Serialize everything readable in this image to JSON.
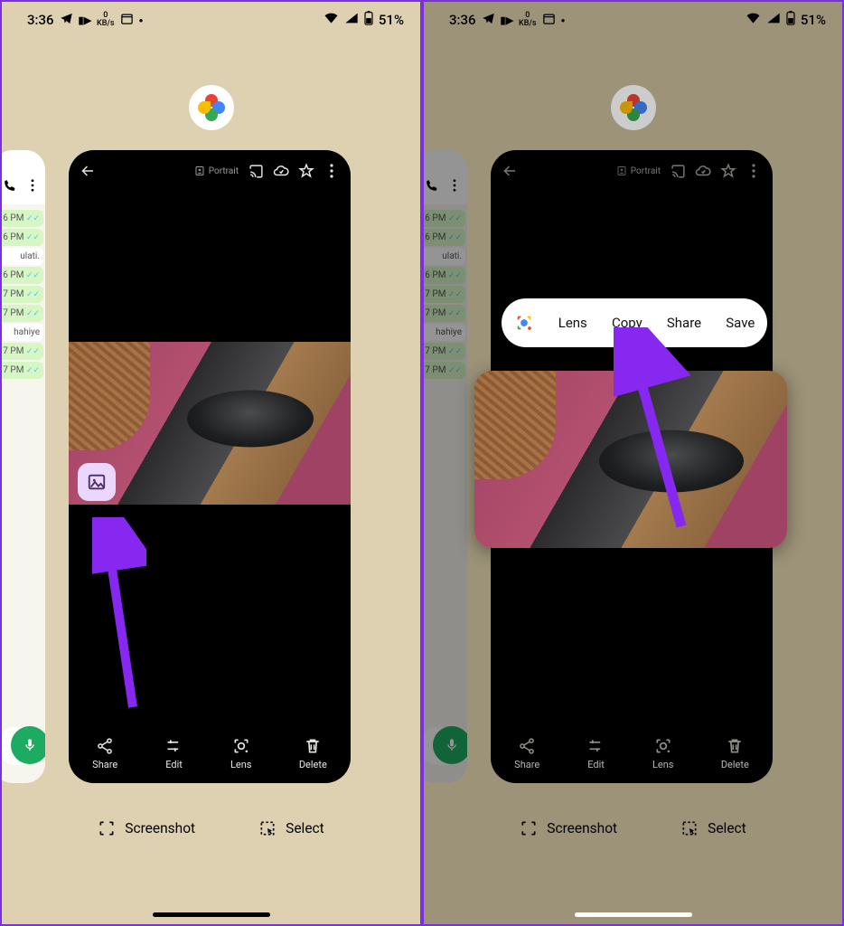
{
  "statusbar": {
    "time": "3:36",
    "kbs_value": "0",
    "kbs_unit": "KB/s",
    "battery": "51%"
  },
  "photo_viewer": {
    "mode_label": "Portrait",
    "bottom": {
      "share": "Share",
      "edit": "Edit",
      "lens": "Lens",
      "delete": "Delete"
    }
  },
  "recents": {
    "screenshot": "Screenshot",
    "select": "Select"
  },
  "popup": {
    "lens": "Lens",
    "copy": "Copy",
    "share": "Share",
    "save": "Save"
  },
  "whatsapp": {
    "timestamps": [
      "6 PM",
      "6 PM",
      "6 PM",
      "7 PM",
      "7 PM",
      "7 PM",
      "7 PM"
    ],
    "in_text_1": "ulati.",
    "in_text_2": "hahiye"
  }
}
